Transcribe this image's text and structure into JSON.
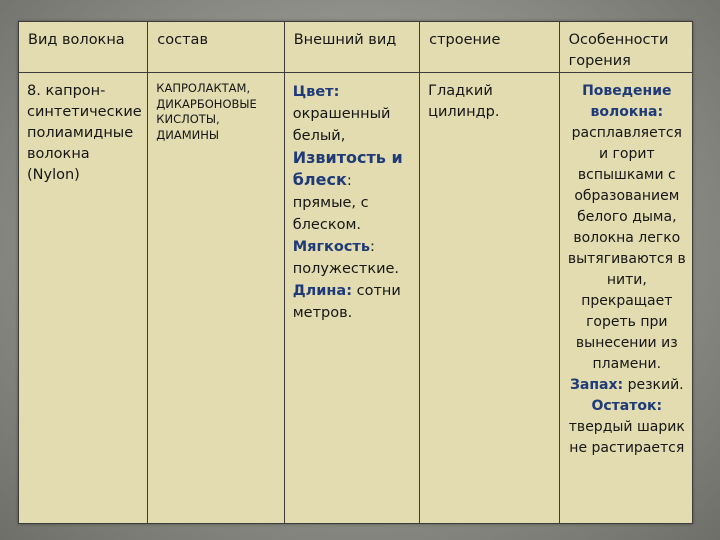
{
  "headers": [
    "Вид волокна",
    "состав",
    "Внешний вид",
    "строение",
    "Особенности горения"
  ],
  "row": {
    "fiber_type": [
      "8. капрон-",
      "синтетические",
      "полиамидные",
      "волокна",
      "(Nylon)"
    ],
    "composition": [
      "КАПРОЛАКТАМ,",
      "ДИКАРБОНОВЫЕ",
      "КИСЛОТЫ,",
      "ДИАМИНЫ"
    ],
    "appearance": {
      "color_label": "Цвет:",
      "color_value": [
        "окрашенный",
        "белый,"
      ],
      "luster_label": [
        "Извитость и",
        "блеск"
      ],
      "luster_colon": ":",
      "luster_value": [
        "прямые, с",
        "блеском."
      ],
      "softness_label": "Мягкость",
      "softness_colon": ":",
      "softness_value": "полужесткие.",
      "length_label": "Длина:",
      "length_value_1": " сотни",
      "length_value_2": "метров."
    },
    "structure": [
      "Гладкий",
      "цилиндр."
    ],
    "burning": {
      "behavior_label": [
        "Поведение",
        "волокна:"
      ],
      "behavior_text": [
        "расплавляется",
        "и горит",
        "вспышками с",
        "образованием",
        "белого дыма,",
        "волокна легко",
        "вытягиваются в",
        "нити,",
        "прекращает",
        "гореть при",
        "вынесении из",
        "пламени."
      ],
      "smell_label": "Запах:",
      "smell_value": " резкий.",
      "residue_label": "Остаток:",
      "residue_text": [
        "твердый шарик",
        "не растирается"
      ]
    }
  }
}
